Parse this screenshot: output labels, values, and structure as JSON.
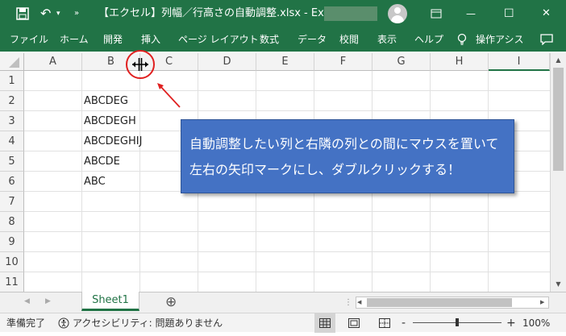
{
  "window": {
    "title": "【エクセル】列幅／行高さの自動調整.xlsx  -  Excel",
    "min": "—",
    "max": "☐",
    "close": "✕"
  },
  "ribbon": {
    "tabs": [
      "ファイル",
      "ホーム",
      "開発",
      "挿入",
      "ページ レイアウト",
      "数式",
      "データ",
      "校閲",
      "表示",
      "ヘルプ",
      "操作アシス"
    ]
  },
  "grid": {
    "columns": [
      "A",
      "B",
      "C",
      "D",
      "E",
      "F",
      "G",
      "H",
      "I"
    ],
    "rows": [
      "1",
      "2",
      "3",
      "4",
      "5",
      "6",
      "7",
      "8",
      "9",
      "10",
      "11"
    ],
    "cells_b": [
      "",
      "ABCDEG",
      "ABCDEGH",
      "ABCDEGHIJ",
      "ABCDE",
      "ABC"
    ]
  },
  "callout": {
    "line1": "自動調整したい列と右隣の列との間にマウスを置いて",
    "line2": "左右の矢印マークにし、ダブルクリックする！"
  },
  "sheets": {
    "active": "Sheet1",
    "add": "⊕"
  },
  "status": {
    "ready": "準備完了",
    "accessibility": "アクセシビリティ: 問題ありません",
    "zoom": "100%",
    "minus": "-",
    "plus": "+"
  },
  "colors": {
    "brand": "#217346",
    "callout": "#4472c4",
    "annotation": "#e02020"
  }
}
